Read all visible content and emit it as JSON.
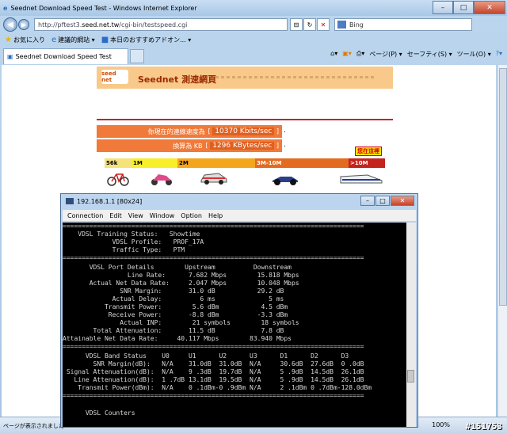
{
  "browser": {
    "window_title": "Seednet Download Speed Test - Windows Internet Explorer",
    "url_prefix": "http://pftest3.",
    "url_domain": "seed.net.tw",
    "url_path": "/cgi-bin/testspeed.cgi",
    "search_placeholder": "Bing",
    "favorites": [
      "お気に入り",
      "建議的網站 ▾",
      "本日のおすすめアドオン... ▾"
    ],
    "tab_label": "Seednet Download Speed Test",
    "cmd_items": [
      "ページ(P) ▾",
      "セーフティ(S) ▾",
      "ツール(O) ▾"
    ],
    "status_text": "ページが表示されました",
    "zoom": "100%"
  },
  "page": {
    "logo": "seed net",
    "brand": "Seednet 測速網頁",
    "speed_row1_label": "你現在的連線速度為",
    "speed_row1_value": "10370 Kbits/sec",
    "speed_row2_label": "換算為 KB",
    "speed_row2_value": "1296 KBytes/sec",
    "dot": ".",
    "badge": "您在這裡",
    "scale": [
      {
        "label": "56k",
        "color": "#f6e27a"
      },
      {
        "label": "1M",
        "color": "#f7ef2a"
      },
      {
        "label": "2M",
        "color": "#f3a51c"
      },
      {
        "label": "3M-10M",
        "color": "#e36b1f"
      },
      {
        "label": ">10M",
        "color": "#c3241e"
      }
    ]
  },
  "terminal": {
    "title": "192.168.1.1 [80x24]",
    "menu": [
      "Connection",
      "Edit",
      "View",
      "Window",
      "Option",
      "Help"
    ],
    "lines": [
      "===============================================================================",
      "    VDSL Training Status:   Showtime",
      "             VDSL Profile:   PROF_17A",
      "             Traffic Type:   PTM",
      "===============================================================================",
      "       VDSL Port Details        Upstream          Downstream",
      "                 Line Rate:      7.682 Mbps        15.818 Mbps",
      "       Actual Net Data Rate:     2.047 Mbps        10.048 Mbps",
      "               SNR Margin:       31.0 dB           29.2 dB",
      "             Actual Delay:          6 ms              5 ms",
      "           Transmit Power:        5.6 dBm           4.5 dBm",
      "            Receive Power:       -8.8 dBm          -3.3 dBm",
      "               Actual INP:        21 symbols        18 symbols",
      "        Total Attenuation:       11.5 dB            7.8 dB",
      "Attainable Net Data Rate:     40.117 Mbps        83.940 Mbps",
      "===============================================================================",
      "      VDSL Band Status    U0     U1      U2      U3      D1      D2      D3",
      "        SNR Margin(dB):   N/A    31.0dB  31.0dB  N/A     30.6dB  27.6dB  0 .0dB",
      " Signal Attenuation(dB):  N/A    9 .3dB  19.7dB  N/A     5 .9dB  14.5dB  26.1dB",
      "   Line Attenuation(dB):  1 .7dB 13.1dB  19.5dB  N/A     5 .9dB  14.5dB  26.1dB",
      "    Transmit Power(dBm):  N/A    0 .1dBm-0 .9dBm N/A     2 .1dBm 0 .7dBm-128.0dBm",
      "===============================================================================",
      "",
      "      VDSL Counters"
    ]
  },
  "shot_id": "#151753"
}
